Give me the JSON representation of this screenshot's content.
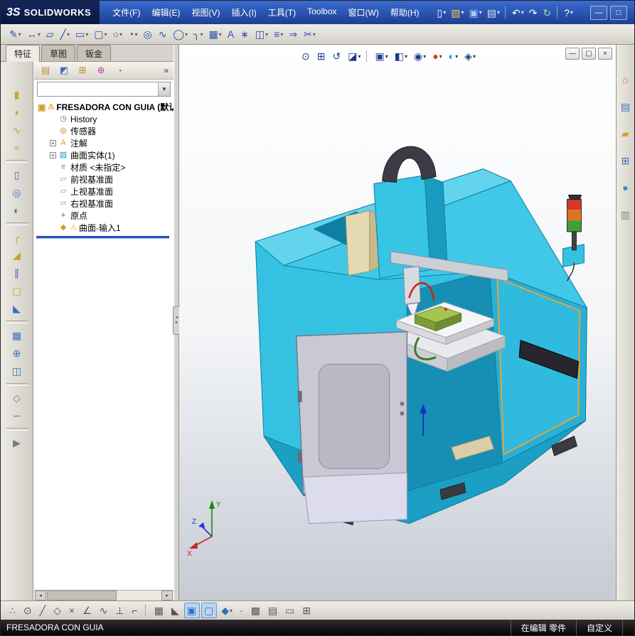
{
  "titlebar": {
    "logo_mark": "3S",
    "logo_text": "SOLIDWORKS",
    "menus": [
      {
        "name": "menu-file",
        "label": "文件(F)"
      },
      {
        "name": "menu-edit",
        "label": "编辑(E)"
      },
      {
        "name": "menu-view",
        "label": "视图(V)"
      },
      {
        "name": "menu-insert",
        "label": "插入(I)"
      },
      {
        "name": "menu-tools",
        "label": "工具(T)"
      },
      {
        "name": "menu-toolbox",
        "label": "Toolbox"
      },
      {
        "name": "menu-window",
        "label": "窗口(W)"
      },
      {
        "name": "menu-help",
        "label": "帮助(H)"
      }
    ],
    "toolbar": [
      {
        "name": "new-document-icon",
        "g": "▯",
        "c": "#ffffff",
        "dd": "▾"
      },
      {
        "name": "open-icon",
        "g": "▨",
        "c": "#f5c542",
        "dd": "▾"
      },
      {
        "name": "save-icon",
        "g": "▣",
        "c": "#a9c6ff",
        "dd": "▾"
      },
      {
        "name": "print-icon",
        "g": "▤",
        "c": "#dde4f2",
        "dd": "▾"
      },
      {
        "name": "toolbar-separator",
        "g": "",
        "c": "",
        "dd": "",
        "cls": "vsep"
      },
      {
        "name": "undo-icon",
        "g": "↶",
        "c": "#ffffff",
        "dd": "▾"
      },
      {
        "name": "redo-icon",
        "g": "↷",
        "c": "#ffffff",
        "dd": ""
      },
      {
        "name": "rebuild-icon",
        "g": "↻",
        "c": "#9fe09f",
        "dd": ""
      },
      {
        "name": "toolbar-separator",
        "g": "",
        "c": "",
        "dd": "",
        "cls": "vsep"
      },
      {
        "name": "help-icon",
        "g": "?",
        "c": "#ffffff",
        "dd": "▾"
      }
    ],
    "window_controls": [
      {
        "name": "window-minimize-icon",
        "g": "—"
      },
      {
        "name": "window-maximize-icon",
        "g": "□"
      }
    ]
  },
  "sketch_toolbar": [
    {
      "name": "sketch-icon",
      "g": "✎",
      "c": "#2b4fae",
      "dd": "▾"
    },
    {
      "name": "smart-dimension-icon",
      "g": "↔",
      "c": "#2b4fae",
      "dd": "▾"
    },
    {
      "name": "eraser-icon",
      "g": "▱",
      "c": "#2b4fae",
      "dd": ""
    },
    {
      "name": "line-icon",
      "g": "╱",
      "c": "#2b4fae",
      "dd": "▾"
    },
    {
      "name": "corner-rectangle-icon",
      "g": "▭",
      "c": "#2b4fae",
      "dd": "▾"
    },
    {
      "name": "straight-slot-icon",
      "g": "▢",
      "c": "#2b4fae",
      "dd": "▾"
    },
    {
      "name": "circle-icon",
      "g": "○",
      "c": "#2b4fae",
      "dd": "▾"
    },
    {
      "name": "centerpoint-arc-icon",
      "g": "◔",
      "c": "#2b4fae",
      "dd": "▾"
    },
    {
      "name": "perimeter-circle-icon",
      "g": "◎",
      "c": "#2b4fae",
      "dd": ""
    },
    {
      "name": "spline-icon",
      "g": "∿",
      "c": "#2b4fae",
      "dd": ""
    },
    {
      "name": "ellipse-icon",
      "g": "◯",
      "c": "#2b4fae",
      "dd": "▾"
    },
    {
      "name": "sketch-fillet-icon",
      "g": "╮",
      "c": "#2b4fae",
      "dd": "▾"
    },
    {
      "name": "linear-sketch-pattern-icon",
      "g": "▦",
      "c": "#2b4fae",
      "dd": "▾"
    },
    {
      "name": "text-icon",
      "g": "A",
      "c": "#2b4fae",
      "dd": ""
    },
    {
      "name": "point-icon",
      "g": "∗",
      "c": "#2b4fae",
      "dd": ""
    },
    {
      "name": "mirror-entities-icon",
      "g": "◫",
      "c": "#2b4fae",
      "dd": "▾"
    },
    {
      "name": "offset-entities-icon",
      "g": "≡",
      "c": "#2b4fae",
      "dd": "▾"
    },
    {
      "name": "convert-entities-icon",
      "g": "⇒",
      "c": "#2b4fae",
      "dd": ""
    },
    {
      "name": "trim-entities-icon",
      "g": "✂",
      "c": "#2b4fae",
      "dd": "▾"
    }
  ],
  "feature_strip": [
    {
      "name": "extruded-boss-icon",
      "g": "▮",
      "c": "#c9a227"
    },
    {
      "name": "revolved-boss-icon",
      "g": "◗",
      "c": "#c9a227"
    },
    {
      "name": "swept-boss-icon",
      "g": "∿",
      "c": "#c9a227"
    },
    {
      "name": "lofted-boss-icon",
      "g": "≈",
      "c": "#c9a227"
    },
    {
      "name": "strip-separator",
      "g": "",
      "c": "",
      "cls": "divider"
    },
    {
      "name": "extruded-cut-icon",
      "g": "▯",
      "c": "#3e6fbf"
    },
    {
      "name": "hole-wizard-icon",
      "g": "◎",
      "c": "#3e6fbf"
    },
    {
      "name": "revolved-cut-icon",
      "g": "◐",
      "c": "#3e6fbf"
    },
    {
      "name": "strip-separator",
      "g": "",
      "c": "",
      "cls": "divider"
    },
    {
      "name": "fillet-icon",
      "g": "╭",
      "c": "#c9a227"
    },
    {
      "name": "chamfer-icon",
      "g": "◢",
      "c": "#c9a227"
    },
    {
      "name": "rib-icon",
      "g": "∥",
      "c": "#3e6fbf"
    },
    {
      "name": "shell-icon",
      "g": "▢",
      "c": "#c9a227"
    },
    {
      "name": "draft-icon",
      "g": "◣",
      "c": "#3e6fbf"
    },
    {
      "name": "strip-separator",
      "g": "",
      "c": "",
      "cls": "divider"
    },
    {
      "name": "linear-pattern-icon",
      "g": "▦",
      "c": "#3e6fbf"
    },
    {
      "name": "circular-pattern-icon",
      "g": "⊕",
      "c": "#3e6fbf"
    },
    {
      "name": "mirror-icon",
      "g": "◫",
      "c": "#3e6fbf"
    },
    {
      "name": "strip-separator",
      "g": "",
      "c": "",
      "cls": "divider"
    },
    {
      "name": "reference-geometry-icon",
      "g": "◇",
      "c": "#6a7c92"
    },
    {
      "name": "curves-icon",
      "g": "∽",
      "c": "#6a7c92"
    },
    {
      "name": "strip-separator",
      "g": "",
      "c": "",
      "cls": "divider"
    },
    {
      "name": "instant3d-icon",
      "g": "▶",
      "c": "#6a7c92"
    }
  ],
  "panel": {
    "tabs": [
      {
        "name": "tab-features",
        "label": "特征",
        "cls": "active"
      },
      {
        "name": "tab-sketch",
        "label": "草图",
        "cls": ""
      },
      {
        "name": "tab-sheet-metal",
        "label": "钣金",
        "cls": ""
      }
    ],
    "manager_icons": [
      {
        "name": "featuremanager-tree-icon",
        "g": "▤",
        "c": "#b8912a"
      },
      {
        "name": "propertymanager-icon",
        "g": "◩",
        "c": "#3e6fbf"
      },
      {
        "name": "configurationmanager-icon",
        "g": "⊞",
        "c": "#b8912a"
      },
      {
        "name": "dimxpertmanager-icon",
        "g": "⊕",
        "c": "#c03ab0"
      },
      {
        "name": "displaymanager-icon",
        "g": "◔",
        "c": "#d06030"
      }
    ],
    "chevron": "»",
    "combo_caret": "▼",
    "hscroll_left": "◂",
    "hscroll_right": "▸",
    "split_left": "◂",
    "split_right": "▸",
    "tree": {
      "root": {
        "g": "▣",
        "warn": "⚠",
        "label": "FRESADORA CON GUIA",
        "suffix": "(默认<"
      },
      "items": [
        {
          "name": "tree-item-history",
          "icon": "history-icon",
          "g": "◷",
          "c": "#2f6fc0",
          "exp": "",
          "warn": "",
          "label": "History"
        },
        {
          "name": "tree-item-sensors",
          "icon": "sensors-icon",
          "g": "◎",
          "c": "#d06a1e",
          "exp": "",
          "warn": "",
          "label": "传感器"
        },
        {
          "name": "tree-item-annotations",
          "icon": "annotations-icon",
          "g": "A",
          "c": "#caa127",
          "exp": "+",
          "warn": "",
          "label": "注解"
        },
        {
          "name": "tree-item-surface-bodies",
          "icon": "surface-bodies-icon",
          "g": "▧",
          "c": "#1a9cc0",
          "exp": "+",
          "warn": "",
          "label": "曲面实体(1)"
        },
        {
          "name": "tree-item-material",
          "icon": "material-icon",
          "g": "≡",
          "c": "#6a7c92",
          "exp": "",
          "warn": "",
          "label": "材质 <未指定>"
        },
        {
          "name": "tree-item-front-plane",
          "icon": "plane-icon",
          "g": "▱",
          "c": "#7a8aa8",
          "exp": "",
          "warn": "",
          "label": "前视基准面"
        },
        {
          "name": "tree-item-top-plane",
          "icon": "plane-icon",
          "g": "▱",
          "c": "#7a8aa8",
          "exp": "",
          "warn": "",
          "label": "上视基准面"
        },
        {
          "name": "tree-item-right-plane",
          "icon": "plane-icon",
          "g": "▱",
          "c": "#7a8aa8",
          "exp": "",
          "warn": "",
          "label": "右视基准面"
        },
        {
          "name": "tree-item-origin",
          "icon": "origin-icon",
          "g": "+",
          "c": "#2f4fc0",
          "exp": "",
          "warn": "",
          "label": "原点"
        },
        {
          "name": "tree-item-surface-import",
          "icon": "surface-import-icon",
          "g": "◆",
          "c": "#caa127",
          "exp": "",
          "warn": "⚠",
          "label": "曲面-输入1"
        }
      ]
    }
  },
  "viewport": {
    "headsup": [
      {
        "name": "zoom-to-fit-icon",
        "g": "⊙",
        "c": "#1b3c8c",
        "dd": ""
      },
      {
        "name": "zoom-to-area-icon",
        "g": "⊞",
        "c": "#1b3c8c",
        "dd": ""
      },
      {
        "name": "previous-view-icon",
        "g": "↺",
        "c": "#1b3c8c",
        "dd": ""
      },
      {
        "name": "section-view-icon",
        "g": "◪",
        "c": "#1b3c8c",
        "dd": "▾"
      },
      {
        "name": "headsup-separator",
        "g": "",
        "c": "",
        "dd": "",
        "cls": "vsep2"
      },
      {
        "name": "view-orientation-icon",
        "g": "▣",
        "c": "#1b3c8c",
        "dd": "▾"
      },
      {
        "name": "display-style-icon",
        "g": "◧",
        "c": "#1b3c8c",
        "dd": "▾"
      },
      {
        "name": "hide-show-items-icon",
        "g": "◉",
        "c": "#1b3c8c",
        "dd": "▾"
      },
      {
        "name": "edit-appearance-icon",
        "g": "●",
        "c": "#d04020",
        "dd": "▾"
      },
      {
        "name": "apply-scene-icon",
        "g": "◐",
        "c": "#2f8fd0",
        "dd": "▾"
      },
      {
        "name": "view-settings-icon",
        "g": "◈",
        "c": "#1b3c8c",
        "dd": "▾"
      }
    ],
    "doc_controls": [
      {
        "name": "doc-minimize-icon",
        "g": "—"
      },
      {
        "name": "doc-restore-icon",
        "g": "▢"
      },
      {
        "name": "doc-close-icon",
        "g": "×"
      }
    ],
    "triad": {
      "x": "X",
      "y": "Y",
      "z": "Z"
    }
  },
  "task_pane": [
    {
      "name": "solidworks-resources-icon",
      "g": "⌂",
      "c": "#d06020"
    },
    {
      "name": "design-library-icon",
      "g": "▤",
      "c": "#3e6fbf"
    },
    {
      "name": "file-explorer-icon",
      "g": "▰",
      "c": "#d8a020"
    },
    {
      "name": "view-palette-icon",
      "g": "⊞",
      "c": "#3e6fbf"
    },
    {
      "name": "appearances-icon",
      "g": "●",
      "c": "#2f8fd0"
    },
    {
      "name": "custom-properties-icon",
      "g": "▥",
      "c": "#888888"
    }
  ],
  "bottom_toolbar": [
    {
      "name": "snap-points-icon",
      "g": "∴",
      "c": "#555555",
      "dd": ""
    },
    {
      "name": "snap-center-icon",
      "g": "⊙",
      "c": "#555555",
      "dd": ""
    },
    {
      "name": "snap-line-icon",
      "g": "╱",
      "c": "#555555",
      "dd": ""
    },
    {
      "name": "snap-midpoint-icon",
      "g": "◇",
      "c": "#555555",
      "dd": ""
    },
    {
      "name": "snap-intersection-icon",
      "g": "×",
      "c": "#555555",
      "dd": ""
    },
    {
      "name": "snap-angle-icon",
      "g": "∠",
      "c": "#555555",
      "dd": ""
    },
    {
      "name": "snap-tangent-icon",
      "g": "∿",
      "c": "#555555",
      "dd": ""
    },
    {
      "name": "snap-perpendicular-icon",
      "g": "⊥",
      "c": "#555555",
      "dd": ""
    },
    {
      "name": "snap-corner-icon",
      "g": "⌐",
      "c": "#555555",
      "dd": ""
    },
    {
      "name": "bottom-separator",
      "g": "",
      "c": "",
      "dd": "",
      "cls": "vsep"
    },
    {
      "name": "grid-icon",
      "g": "▦",
      "c": "#555555",
      "dd": ""
    },
    {
      "name": "triangle-icon",
      "g": "◣",
      "c": "#555555",
      "dd": ""
    },
    {
      "name": "view-cube-icon",
      "g": "▣",
      "c": "#2f6fc0",
      "dd": "",
      "cls": "active"
    },
    {
      "name": "shaded-cube-icon",
      "g": "▢",
      "c": "#2f6fc0",
      "dd": "",
      "cls": "active"
    },
    {
      "name": "diamond-icon",
      "g": "◆",
      "c": "#2f6fc0",
      "dd": "▾"
    },
    {
      "name": "dot-icon",
      "g": "·",
      "c": "#555555",
      "dd": ""
    },
    {
      "name": "pattern-icon",
      "g": "▩",
      "c": "#555555",
      "dd": ""
    },
    {
      "name": "film-icon",
      "g": "▤",
      "c": "#555555",
      "dd": ""
    },
    {
      "name": "screen-icon",
      "g": "▭",
      "c": "#555555",
      "dd": ""
    },
    {
      "name": "table-icon",
      "g": "⊞",
      "c": "#555555",
      "dd": ""
    }
  ],
  "status_bar": {
    "title": "FRESADORA CON GUIA",
    "editing": "在编辑 零件",
    "custom": "自定义"
  }
}
